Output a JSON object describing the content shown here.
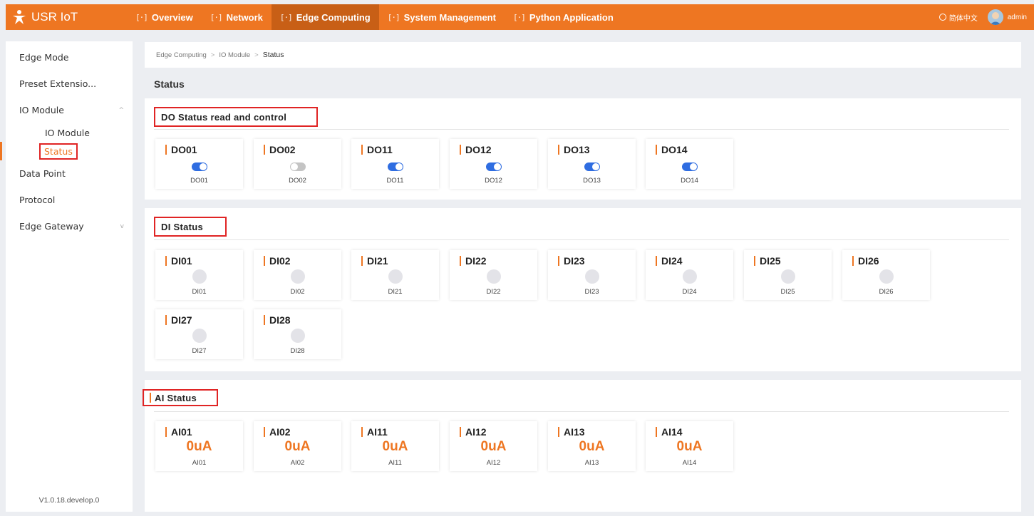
{
  "header": {
    "brand": "USR IoT",
    "nav": [
      {
        "label": "Overview",
        "active": false
      },
      {
        "label": "Network",
        "active": false
      },
      {
        "label": "Edge Computing",
        "active": true
      },
      {
        "label": "System Management",
        "active": false
      },
      {
        "label": "Python Application",
        "active": false
      }
    ],
    "nav_icon": "[·]",
    "language": "简体中文",
    "user": "admin",
    "accent_color": "#ee7622"
  },
  "sidebar": {
    "items": [
      {
        "label": "Edge Mode"
      },
      {
        "label": "Preset Extensio..."
      },
      {
        "label": "IO Module",
        "chevron": "^"
      },
      {
        "label": "Data Point"
      },
      {
        "label": "Protocol"
      },
      {
        "label": "Edge Gateway",
        "chevron": "v"
      }
    ],
    "sub_items": [
      {
        "label": "IO Module"
      },
      {
        "label": "Status"
      }
    ],
    "version": "V1.0.18.develop.0"
  },
  "breadcrumb": [
    "Edge Computing",
    "IO Module",
    "Status"
  ],
  "breadcrumb_sep": ">",
  "page_title": "Status",
  "do_section": {
    "title": "DO Status read and control",
    "items": [
      {
        "name": "DO01",
        "label": "DO01",
        "on": true
      },
      {
        "name": "DO02",
        "label": "DO02",
        "on": false
      },
      {
        "name": "DO11",
        "label": "DO11",
        "on": true
      },
      {
        "name": "DO12",
        "label": "DO12",
        "on": true
      },
      {
        "name": "DO13",
        "label": "DO13",
        "on": true
      },
      {
        "name": "DO14",
        "label": "DO14",
        "on": true
      }
    ]
  },
  "di_section": {
    "title": "DI Status",
    "items": [
      {
        "name": "DI01",
        "label": "DI01"
      },
      {
        "name": "DI02",
        "label": "DI02"
      },
      {
        "name": "DI21",
        "label": "DI21"
      },
      {
        "name": "DI22",
        "label": "DI22"
      },
      {
        "name": "DI23",
        "label": "DI23"
      },
      {
        "name": "DI24",
        "label": "DI24"
      },
      {
        "name": "DI25",
        "label": "DI25"
      },
      {
        "name": "DI26",
        "label": "DI26"
      },
      {
        "name": "DI27",
        "label": "DI27"
      },
      {
        "name": "DI28",
        "label": "DI28"
      }
    ]
  },
  "ai_section": {
    "title": "AI Status",
    "items": [
      {
        "name": "AI01",
        "value": "0uA",
        "label": "AI01"
      },
      {
        "name": "AI02",
        "value": "0uA",
        "label": "AI02"
      },
      {
        "name": "AI11",
        "value": "0uA",
        "label": "AI11"
      },
      {
        "name": "AI12",
        "value": "0uA",
        "label": "AI12"
      },
      {
        "name": "AI13",
        "value": "0uA",
        "label": "AI13"
      },
      {
        "name": "AI14",
        "value": "0uA",
        "label": "AI14"
      }
    ]
  }
}
